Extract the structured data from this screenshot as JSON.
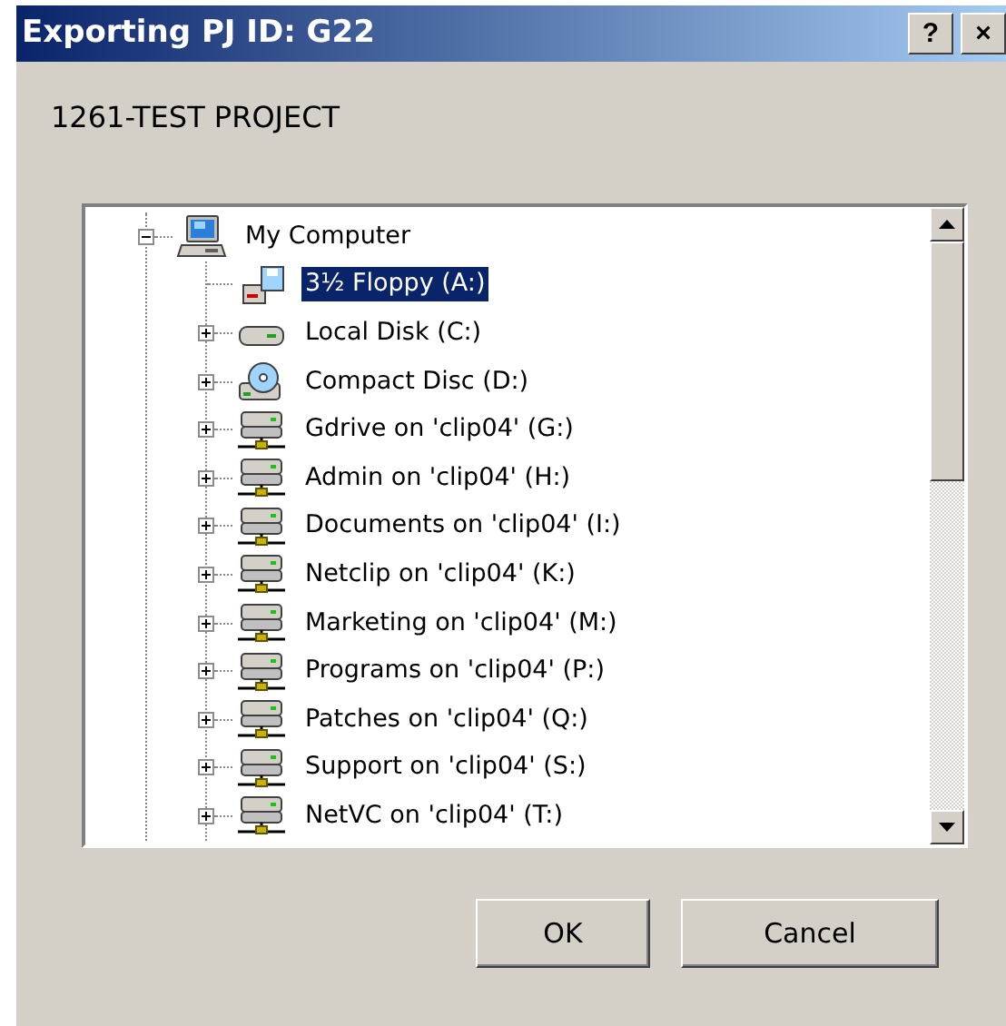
{
  "window": {
    "title": "Exporting PJ ID: G22",
    "title_buttons": [
      "?",
      "×"
    ]
  },
  "project_label": "1261-TEST PROJECT",
  "tree": {
    "items": [
      {
        "label": "My Computer",
        "kind": "computer",
        "expanded": true,
        "selected": false,
        "children": [
          {
            "label": "3½ Floppy (A:)",
            "kind": "floppy",
            "selected": true
          },
          {
            "label": "Local Disk (C:)",
            "kind": "disk",
            "expanded": false,
            "selected": false
          },
          {
            "label": "Compact Disc (D:)",
            "kind": "cd",
            "expanded": false,
            "selected": false
          },
          {
            "label": "Gdrive on 'clip04' (G:)",
            "kind": "network",
            "expanded": false,
            "selected": false
          },
          {
            "label": "Admin on 'clip04' (H:)",
            "kind": "network",
            "expanded": false,
            "selected": false
          },
          {
            "label": "Documents on 'clip04' (I:)",
            "kind": "network",
            "expanded": false,
            "selected": false
          },
          {
            "label": "Netclip on 'clip04' (K:)",
            "kind": "network",
            "expanded": false,
            "selected": false
          },
          {
            "label": "Marketing on 'clip04' (M:)",
            "kind": "network",
            "expanded": false,
            "selected": false
          },
          {
            "label": "Programs on 'clip04' (P:)",
            "kind": "network",
            "expanded": false,
            "selected": false
          },
          {
            "label": "Patches on 'clip04' (Q:)",
            "kind": "network",
            "expanded": false,
            "selected": false
          },
          {
            "label": "Support on 'clip04' (S:)",
            "kind": "network",
            "expanded": false,
            "selected": false
          },
          {
            "label": "NetVC on 'clip04' (T:)",
            "kind": "network",
            "expanded": false,
            "selected": false
          }
        ]
      }
    ]
  },
  "buttons": [
    "OK",
    "Cancel"
  ]
}
